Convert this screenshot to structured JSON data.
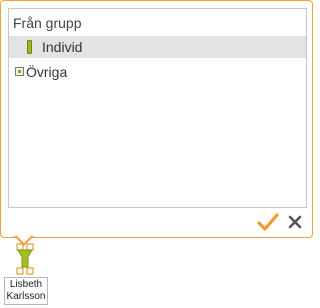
{
  "popup": {
    "group_header": "Från grupp",
    "items": [
      {
        "label": "Individ",
        "icon": "green-bar-icon",
        "selected": true
      },
      {
        "label": "Övriga",
        "icon": "expand-box-icon",
        "selected": false
      }
    ],
    "accent_color": "#f2a23c",
    "confirm_icon": "check-icon",
    "cancel_icon": "close-icon"
  },
  "node": {
    "icon": "person-node-icon",
    "name_line1": "Lisbeth",
    "name_line2": "Karlsson",
    "color": "#9ab81e"
  }
}
